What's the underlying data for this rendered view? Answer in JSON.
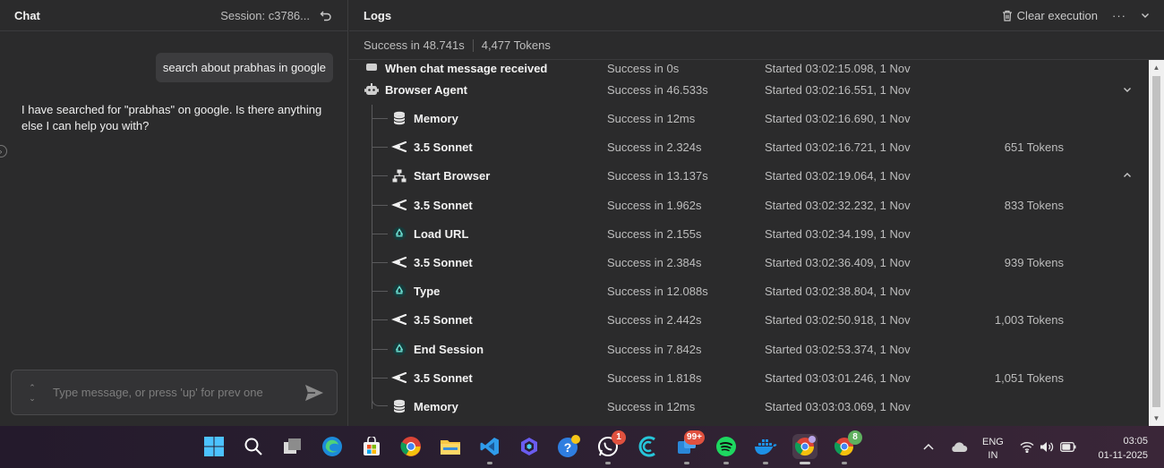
{
  "chat": {
    "title": "Chat",
    "session": "Session: c3786...",
    "user_message": "search about prabhas in google",
    "bot_message": "I have searched for \"prabhas\" on google. Is there anything else I can help you with?",
    "input_placeholder": "Type message, or press 'up' for prev one"
  },
  "logs": {
    "title": "Logs",
    "clear_label": "Clear execution",
    "summary_status": "Success in 48.741s",
    "summary_tokens": "4,477 Tokens",
    "cut_row": {
      "name": "When chat message received",
      "status": "Success in 0s",
      "started": "Started 03:02:15.098, 1 Nov"
    },
    "agent_row": {
      "name": "Browser Agent",
      "status": "Success in 46.533s",
      "started": "Started 03:02:16.551, 1 Nov"
    },
    "rows": [
      {
        "name": "Memory",
        "icon": "database-icon",
        "status": "Success in 12ms",
        "started": "Started 03:02:16.690, 1 Nov",
        "tokens": ""
      },
      {
        "name": "3.5 Sonnet",
        "icon": "anthropic-icon",
        "status": "Success in 2.324s",
        "started": "Started 03:02:16.721, 1 Nov",
        "tokens": "651 Tokens"
      },
      {
        "name": "Start Browser",
        "icon": "network-icon",
        "status": "Success in 13.137s",
        "started": "Started 03:02:19.064, 1 Nov",
        "tokens": ""
      },
      {
        "name": "3.5 Sonnet",
        "icon": "anthropic-icon",
        "status": "Success in 1.962s",
        "started": "Started 03:02:32.232, 1 Nov",
        "tokens": "833 Tokens"
      },
      {
        "name": "Load URL",
        "icon": "recycle-icon",
        "status": "Success in 2.155s",
        "started": "Started 03:02:34.199, 1 Nov",
        "tokens": ""
      },
      {
        "name": "3.5 Sonnet",
        "icon": "anthropic-icon",
        "status": "Success in 2.384s",
        "started": "Started 03:02:36.409, 1 Nov",
        "tokens": "939 Tokens"
      },
      {
        "name": "Type",
        "icon": "recycle-icon",
        "status": "Success in 12.088s",
        "started": "Started 03:02:38.804, 1 Nov",
        "tokens": ""
      },
      {
        "name": "3.5 Sonnet",
        "icon": "anthropic-icon",
        "status": "Success in 2.442s",
        "started": "Started 03:02:50.918, 1 Nov",
        "tokens": "1,003 Tokens"
      },
      {
        "name": "End Session",
        "icon": "recycle-icon",
        "status": "Success in 7.842s",
        "started": "Started 03:02:53.374, 1 Nov",
        "tokens": ""
      },
      {
        "name": "3.5 Sonnet",
        "icon": "anthropic-icon",
        "status": "Success in 1.818s",
        "started": "Started 03:03:01.246, 1 Nov",
        "tokens": "1,051 Tokens"
      },
      {
        "name": "Memory",
        "icon": "database-icon",
        "status": "Success in 12ms",
        "started": "Started 03:03:03.069, 1 Nov",
        "tokens": ""
      }
    ]
  },
  "taskbar": {
    "whatsapp_badge": "1",
    "teams_badge": "99+",
    "chrome2_badge": "8",
    "lang_line1": "ENG",
    "lang_line2": "IN",
    "time": "03:05",
    "date": "01-11-2025"
  },
  "colors": {
    "panel_bg": "#2b2b2c",
    "text_primary": "#f2f2f2",
    "text_secondary": "#bdbdbd"
  }
}
